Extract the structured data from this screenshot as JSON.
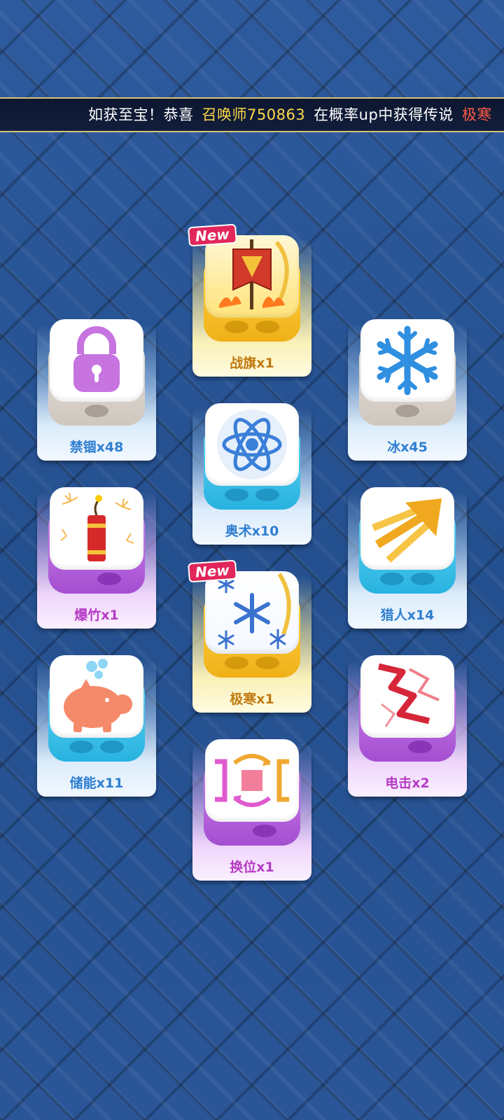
{
  "ticker": {
    "prefix": "如获至宝！恭喜",
    "player": "召唤师750863",
    "middle": "在概率up中获得传说",
    "item": "极寒"
  },
  "badge_text": "New",
  "dice": [
    {
      "id": "banner",
      "label": "战旗x1",
      "rarity": "gold",
      "is_new": true,
      "icon": "war-banner-icon"
    },
    {
      "id": "lock",
      "label": "禁锢x48",
      "rarity": "white",
      "is_new": false,
      "icon": "lock-icon"
    },
    {
      "id": "ice",
      "label": "冰x45",
      "rarity": "white",
      "is_new": false,
      "icon": "snowflake-icon"
    },
    {
      "id": "arcane",
      "label": "奥术x10",
      "rarity": "blue",
      "is_new": false,
      "icon": "atom-icon"
    },
    {
      "id": "firecracker",
      "label": "爆竹x1",
      "rarity": "purple",
      "is_new": false,
      "icon": "firecracker-icon"
    },
    {
      "id": "hunter",
      "label": "猎人x14",
      "rarity": "blue",
      "is_new": false,
      "icon": "arrow-icon"
    },
    {
      "id": "frost",
      "label": "极寒x1",
      "rarity": "gold",
      "is_new": true,
      "icon": "blizzard-icon"
    },
    {
      "id": "energy",
      "label": "储能x11",
      "rarity": "blue",
      "is_new": false,
      "icon": "piggy-bank-icon"
    },
    {
      "id": "shock",
      "label": "电击x2",
      "rarity": "purple",
      "is_new": false,
      "icon": "lightning-icon"
    },
    {
      "id": "swap",
      "label": "换位x1",
      "rarity": "purple",
      "is_new": false,
      "icon": "swap-icon"
    }
  ],
  "colors": {
    "background": "#2a5596",
    "ticker_name": "#ffd94a",
    "ticker_item": "#ff5a4a",
    "new_badge": "#e0265a"
  }
}
